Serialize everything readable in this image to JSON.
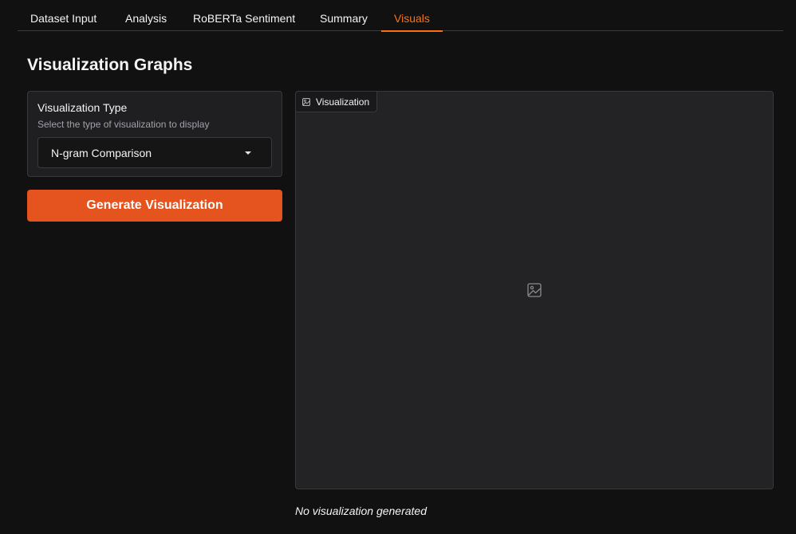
{
  "tabs": [
    {
      "label": "Dataset Input"
    },
    {
      "label": "Analysis"
    },
    {
      "label": "RoBERTa Sentiment"
    },
    {
      "label": "Summary"
    },
    {
      "label": "Visuals"
    }
  ],
  "active_tab": "Visuals",
  "accent_color": "#f97316",
  "button_color": "#e5531f",
  "page_title": "Visualization Graphs",
  "viz_type": {
    "label": "Visualization Type",
    "info": "Select the type of visualization to display",
    "selected": "N-gram Comparison"
  },
  "generate_button": {
    "label": "Generate Visualization"
  },
  "visualization": {
    "label": "Visualization",
    "label_icon": "image-icon",
    "placeholder_icon": "image-icon",
    "status": "No visualization generated"
  }
}
